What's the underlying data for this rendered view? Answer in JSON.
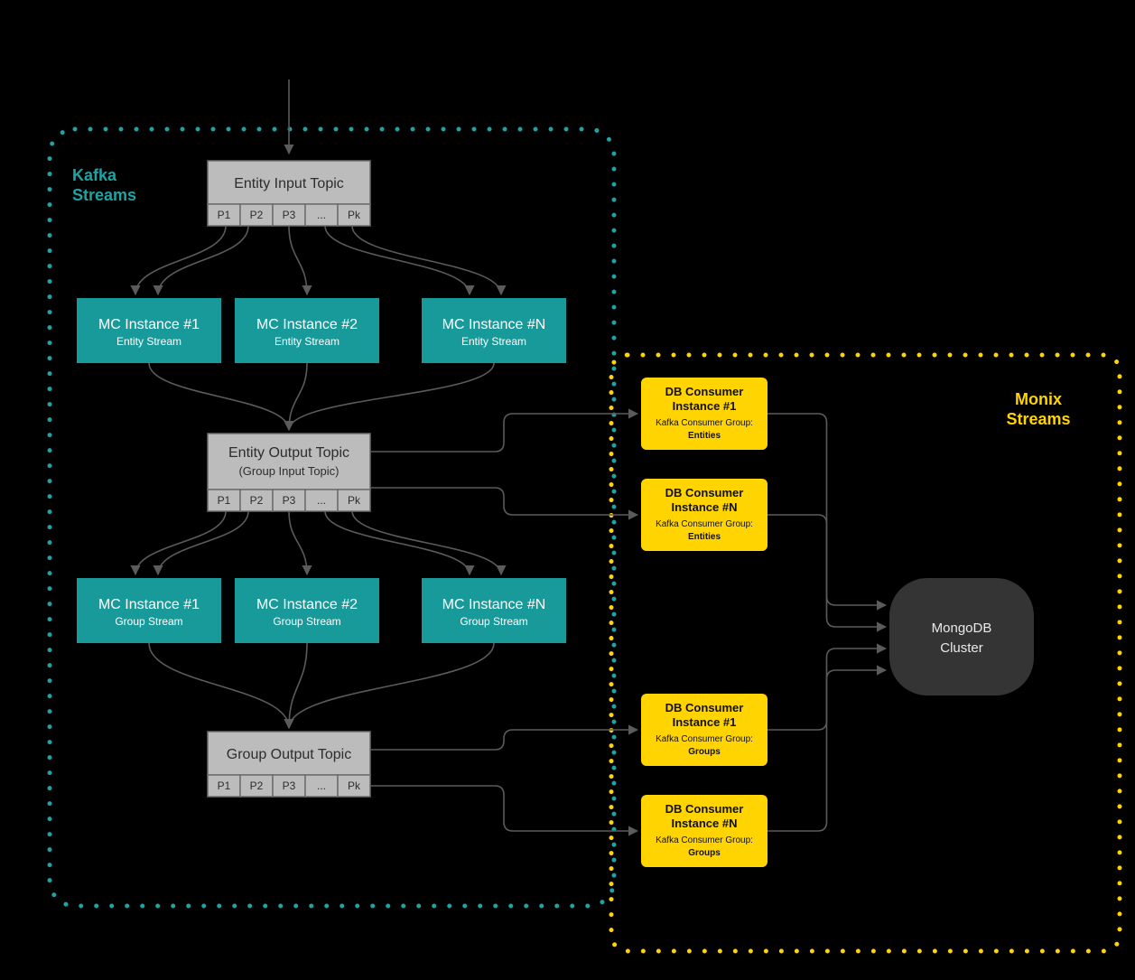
{
  "zones": {
    "kafka": {
      "label1": "Kafka",
      "label2": "Streams",
      "color": "#1fa3a3"
    },
    "monix": {
      "label1": "Monix",
      "label2": "Streams",
      "color": "#ffd400"
    }
  },
  "partitions": [
    "P1",
    "P2",
    "P3",
    "...",
    "Pk"
  ],
  "topics": {
    "entityInput": {
      "title": "Entity Input Topic",
      "subtitle": ""
    },
    "entityOutput": {
      "title": "Entity Output Topic",
      "subtitle": "(Group Input Topic)"
    },
    "groupOutput": {
      "title": "Group Output Topic",
      "subtitle": ""
    }
  },
  "mcRowA": [
    {
      "title": "MC Instance #1",
      "sub": "Entity Stream"
    },
    {
      "title": "MC Instance #2",
      "sub": "Entity Stream"
    },
    {
      "title": "MC Instance #N",
      "sub": "Entity Stream"
    }
  ],
  "mcRowB": [
    {
      "title": "MC Instance #1",
      "sub": "Group Stream"
    },
    {
      "title": "MC Instance #2",
      "sub": "Group Stream"
    },
    {
      "title": "MC Instance #N",
      "sub": "Group Stream"
    }
  ],
  "dbConsumers": [
    {
      "title1": "DB Consumer",
      "title2": "Instance #1",
      "sub": "Kafka Consumer Group:",
      "group": "Entities"
    },
    {
      "title1": "DB Consumer",
      "title2": "Instance #N",
      "sub": "Kafka Consumer Group:",
      "group": "Entities"
    },
    {
      "title1": "DB Consumer",
      "title2": "Instance #1",
      "sub": "Kafka Consumer Group:",
      "group": "Groups"
    },
    {
      "title1": "DB Consumer",
      "title2": "Instance #N",
      "sub": "Kafka Consumer Group:",
      "group": "Groups"
    }
  ],
  "mongo": {
    "l1": "MongoDB",
    "l2": "Cluster"
  },
  "colors": {
    "topicFill": "#bcbcbc",
    "topicStroke": "#6d6d6d",
    "mcFill": "#189a9a",
    "dbFill": "#ffd400",
    "mongoFill": "#343434",
    "arrow": "#5b5b5b"
  }
}
